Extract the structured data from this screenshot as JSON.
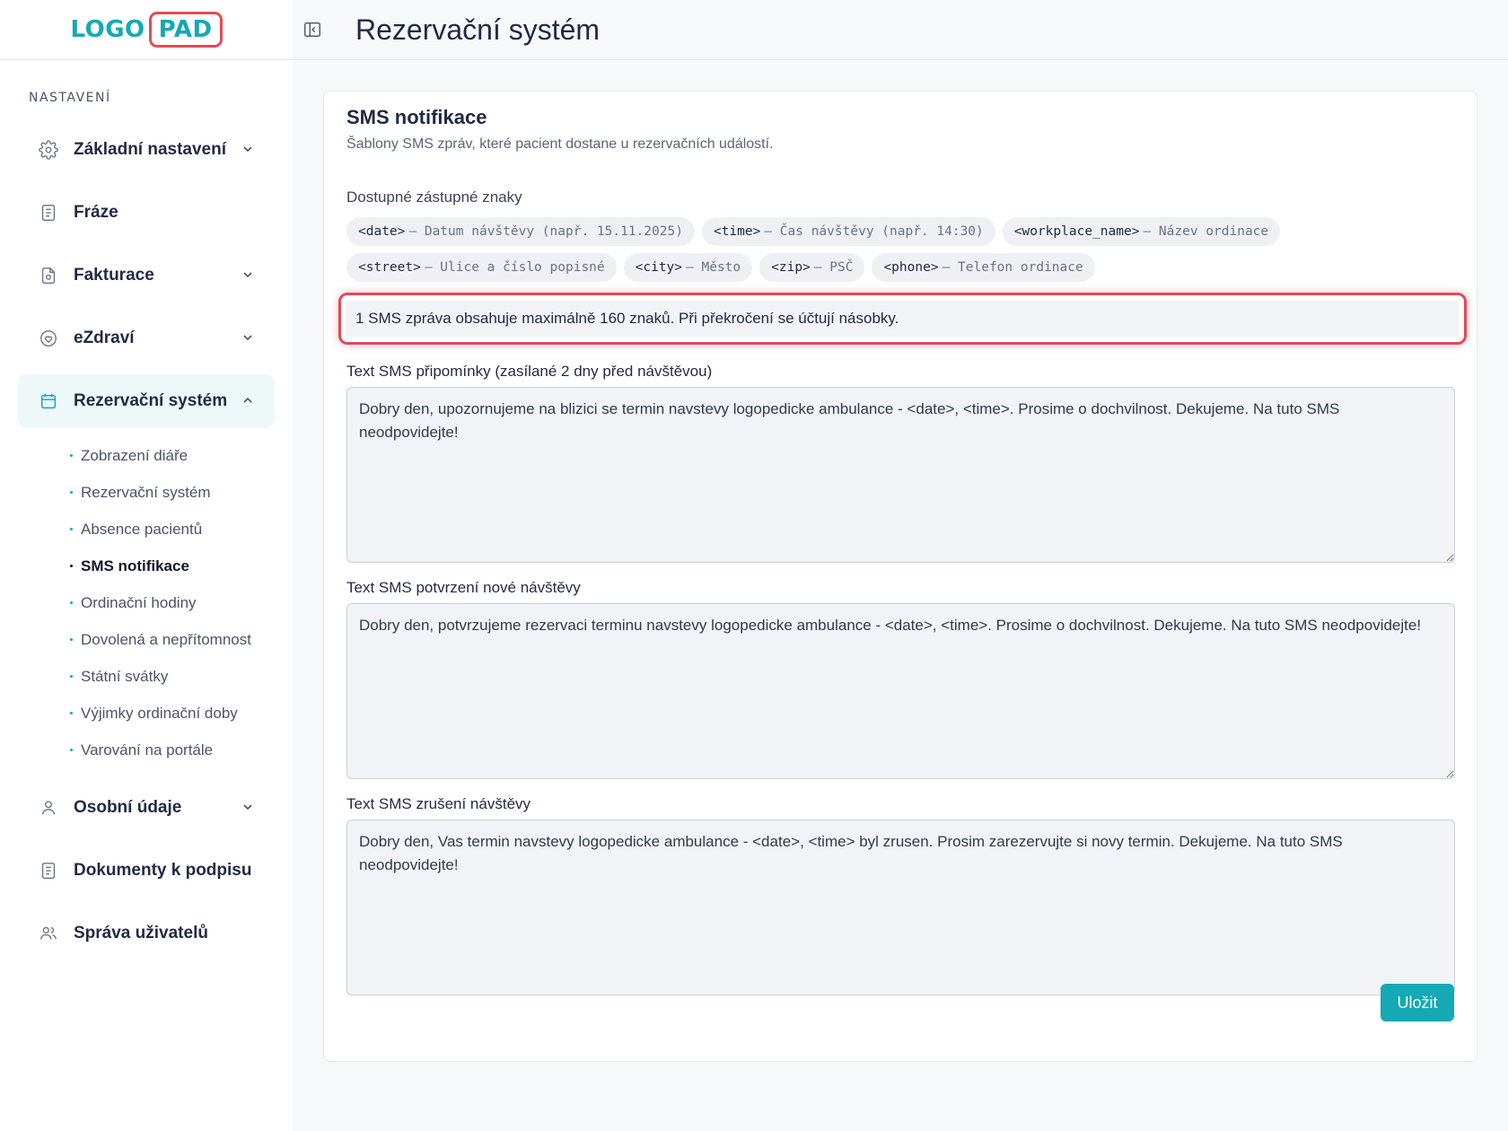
{
  "logo": {
    "left": "LOGO",
    "right": "PAD"
  },
  "topbar": {
    "title": "Rezervační systém"
  },
  "sidebar": {
    "section_title": "NASTAVENÍ",
    "items": [
      {
        "label": "Základní nastavení",
        "icon": "gear-icon",
        "has_chevron": true
      },
      {
        "label": "Fráze",
        "icon": "document-icon",
        "has_chevron": false
      },
      {
        "label": "Fakturace",
        "icon": "invoice-icon",
        "has_chevron": true
      },
      {
        "label": "eZdraví",
        "icon": "heart-shield-icon",
        "has_chevron": true
      },
      {
        "label": "Rezervační systém",
        "icon": "calendar-icon",
        "has_chevron": true,
        "active": true
      },
      {
        "label": "Osobní údaje",
        "icon": "user-icon",
        "has_chevron": true
      },
      {
        "label": "Dokumenty k podpisu",
        "icon": "document-icon",
        "has_chevron": false
      },
      {
        "label": "Správa uživatelů",
        "icon": "users-icon",
        "has_chevron": false
      }
    ],
    "subitems": [
      "Zobrazení diáře",
      "Rezervační systém",
      "Absence pacientů",
      "SMS notifikace",
      "Ordinační hodiny",
      "Dovolená a nepřítomnost",
      "Státní svátky",
      "Výjimky ordinační doby",
      "Varování na portále"
    ]
  },
  "card": {
    "title": "SMS notifikace",
    "subtitle": "Šablony SMS zpráv, které pacient dostane u rezervačních událostí.",
    "placeholders_title": "Dostupné zástupné znaky",
    "placeholders": [
      {
        "code": "<date>",
        "desc": "– Datum návštěvy (např. 15.11.2025)"
      },
      {
        "code": "<time>",
        "desc": "– Čas návštěvy (např. 14:30)"
      },
      {
        "code": "<workplace_name>",
        "desc": "– Název ordinace"
      },
      {
        "code": "<street>",
        "desc": "– Ulice a číslo popisné"
      },
      {
        "code": "<city>",
        "desc": "– Město"
      },
      {
        "code": "<zip>",
        "desc": "– PSČ"
      },
      {
        "code": "<phone>",
        "desc": "– Telefon ordinace"
      }
    ],
    "notice": "1 SMS zpráva obsahuje maximálně 160 znaků. Při překročení se účtují násobky.",
    "fields": [
      {
        "label": "Text SMS připomínky (zasílané 2 dny před návštěvou)",
        "value": "Dobry den, upozornujeme na blizici se termin navstevy logopedicke ambulance - <date>, <time>. Prosime o dochvilnost. Dekujeme. Na tuto SMS neodpovidejte!"
      },
      {
        "label": "Text SMS potvrzení nové návštěvy",
        "value": "Dobry den, potvrzujeme rezervaci terminu navstevy logopedicke ambulance - <date>, <time>. Prosime o dochvilnost. Dekujeme. Na tuto SMS neodpovidejte!"
      },
      {
        "label": "Text SMS zrušení návštěvy",
        "value": "Dobry den, Vas termin navstevy logopedicke ambulance - <date>, <time> byl zrusen. Prosim zarezervujte si novy termin. Dekujeme. Na tuto SMS neodpovidejte!"
      }
    ],
    "save_label": "Uložit"
  },
  "colors": {
    "accent": "#14a9b5",
    "highlight": "#e24b55"
  }
}
